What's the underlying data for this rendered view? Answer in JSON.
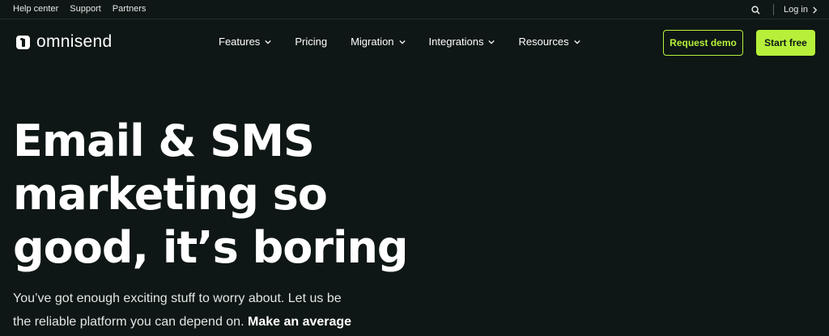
{
  "topbar": {
    "links": [
      "Help center",
      "Support",
      "Partners"
    ],
    "login_label": "Log in"
  },
  "brand": {
    "name": "omnisend"
  },
  "nav": {
    "items": [
      {
        "label": "Features",
        "has_dropdown": true
      },
      {
        "label": "Pricing",
        "has_dropdown": false
      },
      {
        "label": "Migration",
        "has_dropdown": true
      },
      {
        "label": "Integrations",
        "has_dropdown": true
      },
      {
        "label": "Resources",
        "has_dropdown": true
      }
    ],
    "request_demo_label": "Request demo",
    "start_free_label": "Start free"
  },
  "hero": {
    "title_lines": [
      "Email & SMS",
      "marketing so",
      "good, it’s boring"
    ],
    "subtitle_lines": [
      "You’ve got enough exciting stuff to worry about. Let us be",
      "the reliable platform you can depend on."
    ],
    "subtitle_emphasis": "Make an average"
  },
  "colors": {
    "background": "#0e1715",
    "accent": "#b6f03a",
    "text": "#ffffff"
  },
  "icons": {
    "search": "search-icon",
    "login_arrow": "chevron-right-icon",
    "dropdown": "chevron-down-icon",
    "logo": "omnisend-logo-icon"
  }
}
